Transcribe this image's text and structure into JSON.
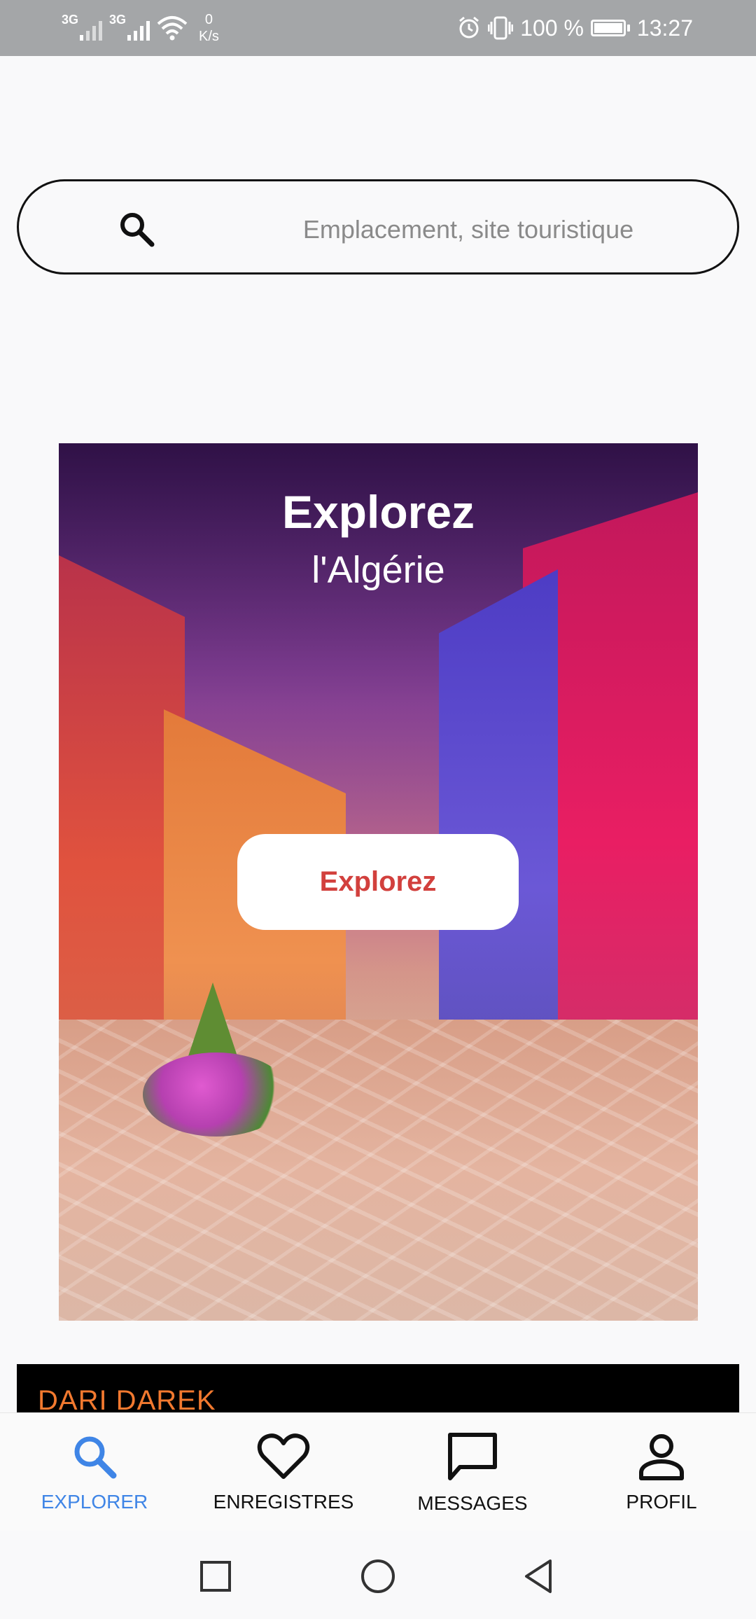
{
  "status_bar": {
    "signal1_tag": "3G",
    "signal2_tag": "3G",
    "speed_value": "0",
    "speed_unit": "K/s",
    "battery_text": "100 %",
    "time": "13:27"
  },
  "search": {
    "placeholder": "Emplacement, site touristique",
    "icon": "search-icon"
  },
  "hero": {
    "title": "Explorez",
    "subtitle": "l'Algérie",
    "button_label": "Explorez",
    "button_color": "#d2403d"
  },
  "section": {
    "title": "DARI DAREK",
    "title_color": "#f2792f"
  },
  "bottom_nav": {
    "tabs": [
      {
        "label": "EXPLORER",
        "icon": "search-icon",
        "active": true
      },
      {
        "label": "ENREGISTRES",
        "icon": "heart-icon",
        "active": false
      },
      {
        "label": "MESSAGES",
        "icon": "message-icon",
        "active": false
      },
      {
        "label": "PROFIL",
        "icon": "user-icon",
        "active": false
      }
    ],
    "active_color": "#3f85e6"
  },
  "system_nav": {
    "buttons": [
      "recent-apps-icon",
      "home-icon",
      "back-icon"
    ]
  }
}
